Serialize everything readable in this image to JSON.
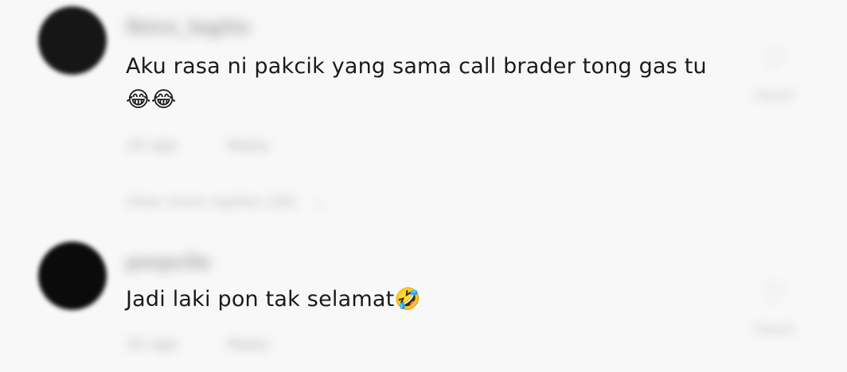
{
  "comments": [
    {
      "username": "lbinx_lagito",
      "text": "Aku rasa ni pakcik yang sama call brader tong gas tu 😂😂",
      "time": "10 ago",
      "reply_label": "Reply",
      "view_replies": "View more replies (26)",
      "like_count": "Heart"
    },
    {
      "username": "pmpclle",
      "text": "Jadi laki pon tak selamat🤣",
      "time": "10 ago",
      "reply_label": "Reply",
      "like_count": "Heart"
    }
  ],
  "icons": {
    "avatar": "avatar",
    "like": "heart-icon",
    "expand": "chevron-down-icon"
  },
  "colors": {
    "background": "#f8f8f8",
    "text": "#1a1a1a",
    "muted": "#b5b5b5"
  }
}
